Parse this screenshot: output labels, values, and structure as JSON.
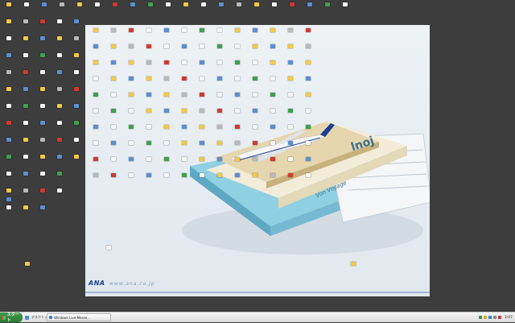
{
  "desktop": {
    "columns_left": [
      [
        "",
        "",
        "",
        "",
        "",
        "",
        "",
        "",
        "",
        "",
        "",
        ""
      ],
      [
        "",
        "",
        "",
        "",
        "",
        "",
        "",
        "",
        "",
        "",
        "",
        ""
      ],
      [
        "",
        "",
        "",
        "",
        "",
        "",
        "",
        "",
        "",
        "",
        "",
        ""
      ],
      [
        "",
        "",
        "",
        "",
        "",
        "",
        "",
        "",
        "",
        "",
        ""
      ],
      [
        "",
        "",
        "",
        "",
        "",
        "",
        "",
        "",
        ""
      ]
    ],
    "top_row": [
      "",
      "",
      "",
      "",
      "",
      "",
      "",
      "",
      "",
      "",
      "",
      "",
      "",
      "",
      "",
      "",
      "",
      "",
      "",
      ""
    ],
    "wall_grid_cols": 13,
    "wall_grid_rows": 10,
    "standalone_left": "",
    "standalone_wall_1": "",
    "standalone_wall_2": ""
  },
  "wallpaper": {
    "brand": "ANA",
    "url": "www.ana.co.jp",
    "book_label_1": "Von Voyage",
    "book_label_2": "lnoj"
  },
  "taskbar": {
    "start_label": "スタート",
    "quicklaunch_label": "デスクトップ",
    "task_label": "Windows Live Messe...",
    "clock": "3:07"
  },
  "colors": {
    "desktop_bg": "#3d3d3d",
    "taskbar_bg": "#e4e4e4",
    "start_green": "#3f9a48",
    "brand_blue": "#1b3f92"
  },
  "icons": {
    "folder": "folder-icon",
    "document": "document-icon",
    "application": "application-icon"
  }
}
